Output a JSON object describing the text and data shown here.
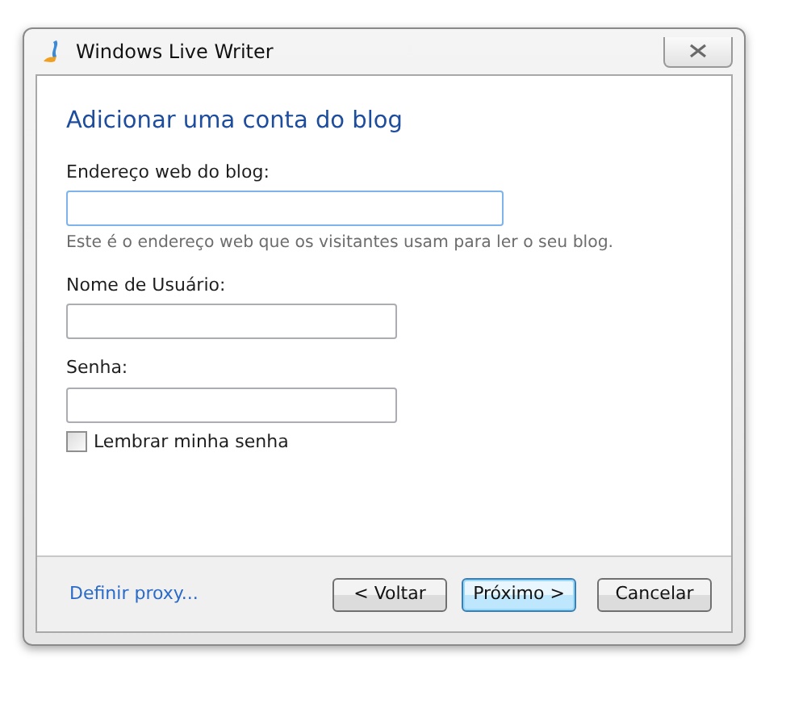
{
  "window": {
    "title": "Windows Live Writer"
  },
  "heading": "Adicionar uma conta do blog",
  "fields": [
    {
      "label": "Endereço web do blog:",
      "focused": true,
      "wide": true,
      "hint": "Este é o endereço web que os visitantes usam para ler o seu blog."
    },
    {
      "label": "Nome de Usuário:",
      "focused": false,
      "wide": false
    },
    {
      "label": "Senha:",
      "focused": false,
      "wide": false
    }
  ],
  "remember": {
    "label": "Lembrar minha senha",
    "checked": false
  },
  "footer": {
    "link": "Definir proxy...",
    "buttons": [
      {
        "label": "< Voltar",
        "default": false
      },
      {
        "label": "Próximo >",
        "default": true
      },
      {
        "label": "Cancelar",
        "default": false
      }
    ]
  }
}
